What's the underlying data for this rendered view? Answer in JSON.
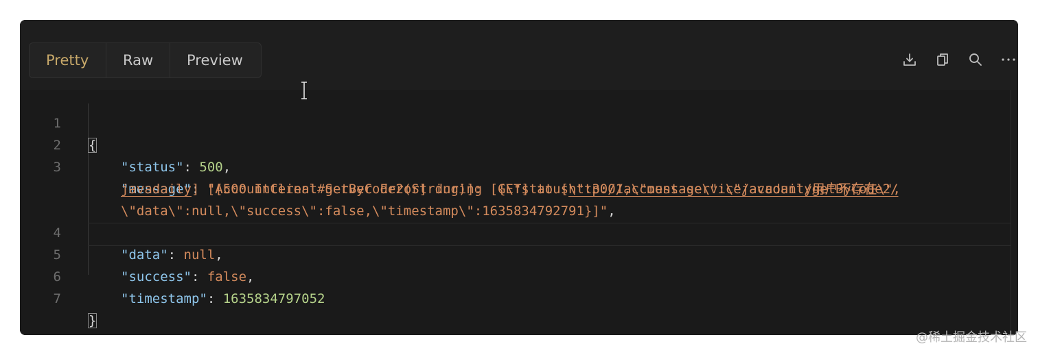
{
  "tabs": [
    {
      "label": "Pretty",
      "active": true
    },
    {
      "label": "Raw",
      "active": false
    },
    {
      "label": "Preview",
      "active": false
    }
  ],
  "toolbar_icons": [
    "download-icon",
    "copy-icon",
    "search-icon",
    "more-icon"
  ],
  "colors": {
    "background": "#1a1a1a",
    "active_tab": "#c8a96a",
    "key": "#8ec5ea",
    "number": "#b5d28a",
    "string": "#d38a5c"
  },
  "editor": {
    "line_numbers": [
      "1",
      "2",
      "3",
      "4",
      "5",
      "6",
      "7"
    ],
    "open_brace": "{",
    "close_brace": "}",
    "status_key": "\"status\"",
    "status_value": "500",
    "message_key": "\"message\"",
    "message_part1": "\"[500 Internal Server Error] during [GET] to [",
    "message_url1": "http://account-service/account/getByCode2/",
    "message_url2": "javadaily",
    "message_part2": "] [AccountClient#getByCode2(String)]: [{\\\"status\\\":3001,\\\"message\\\":\\\"javadaily用户不存在\\\",",
    "message_part3": "\\\"data\\\":null,\\\"success\\\":false,\\\"timestamp\\\":1635834792791}]\"",
    "data_key": "\"data\"",
    "data_value": "null",
    "success_key": "\"success\"",
    "success_value": "false",
    "timestamp_key": "\"timestamp\"",
    "timestamp_value": "1635834797052",
    "colon": ": ",
    "comma": ","
  },
  "watermark": "@稀土掘金技术社区"
}
